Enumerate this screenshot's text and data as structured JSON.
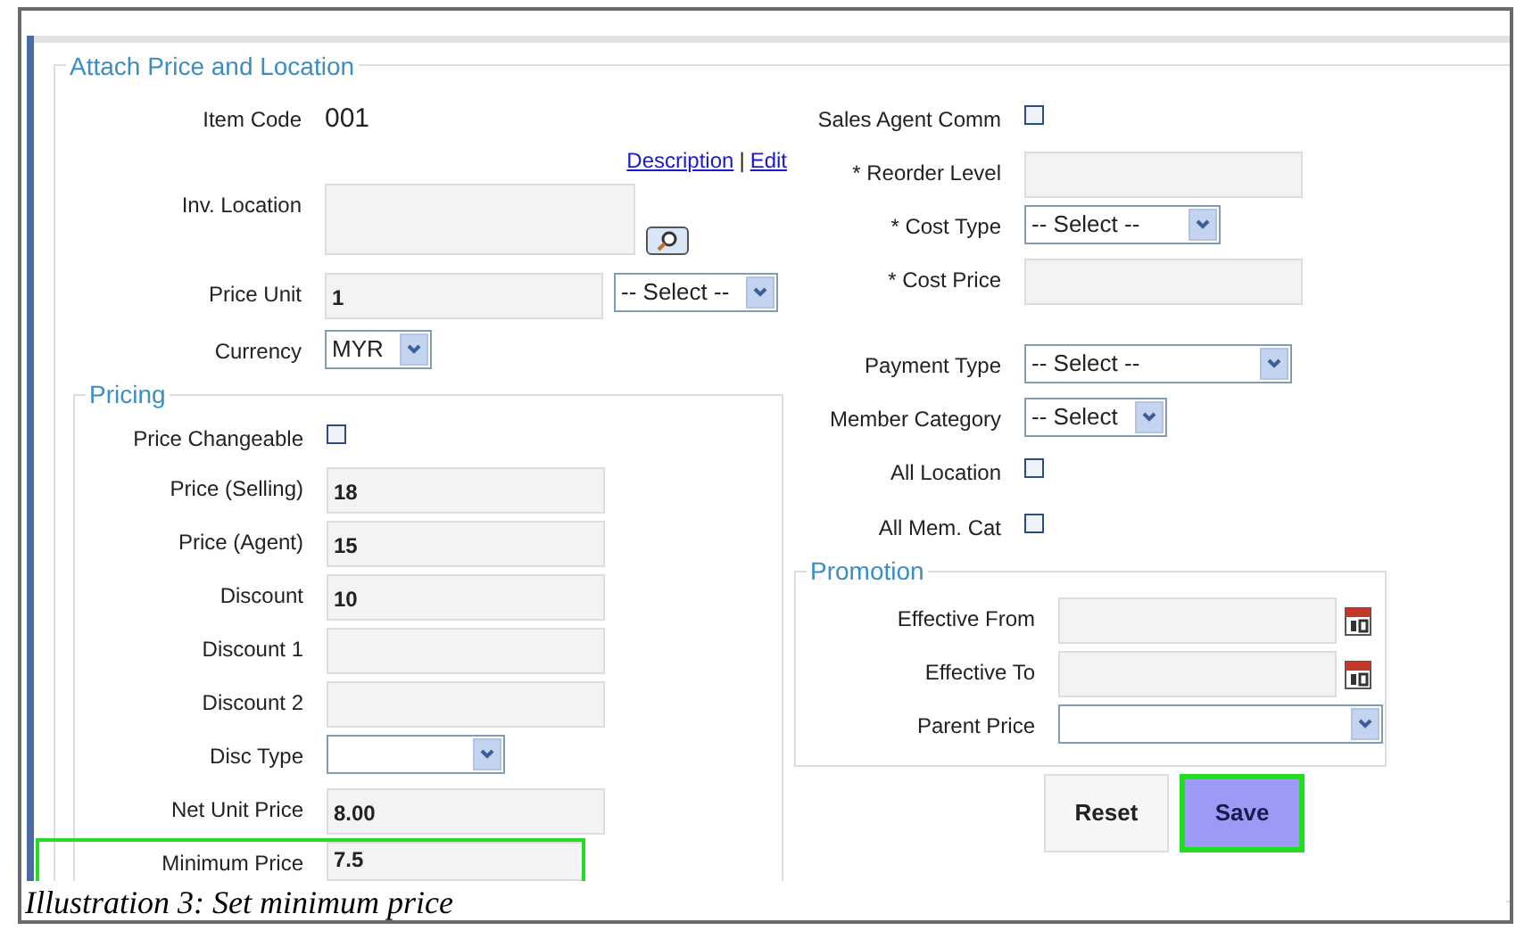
{
  "form": {
    "legend": "Attach Price and Location"
  },
  "left_rows": [
    {
      "kind": "text",
      "label": "Item Code",
      "value": "001"
    },
    {
      "kind": "links",
      "links": [
        "Description",
        "Edit"
      ],
      "separator": "|"
    },
    {
      "kind": "textarea",
      "label": "Inv. Location",
      "value": ""
    },
    {
      "kind": "input_select",
      "label": "Price Unit",
      "value": "1",
      "option": "-- Select --"
    },
    {
      "kind": "select",
      "label": "Currency",
      "value": "MYR"
    }
  ],
  "pricing": {
    "legend": "Pricing",
    "rows": [
      {
        "kind": "checkbox",
        "label": "Price Changeable",
        "checked": false
      },
      {
        "kind": "input",
        "label": "Price (Selling)",
        "value": "18",
        "highlighted": false
      },
      {
        "kind": "input",
        "label": "Price (Agent)",
        "value": "15",
        "highlighted": false
      },
      {
        "kind": "input",
        "label": "Discount",
        "value": "10",
        "highlighted": false
      },
      {
        "kind": "input",
        "label": "Discount 1",
        "value": "",
        "highlighted": false
      },
      {
        "kind": "input",
        "label": "Discount 2",
        "value": "",
        "highlighted": false
      },
      {
        "kind": "select",
        "label": "Disc Type",
        "value": ""
      },
      {
        "kind": "input",
        "label": "Net Unit Price",
        "value": "8.00",
        "highlighted": false
      },
      {
        "kind": "input",
        "label": "Minimum Price",
        "value": "7.5",
        "highlighted": true
      }
    ]
  },
  "right_rows": [
    {
      "kind": "checkbox",
      "label": "Sales Agent Comm",
      "checked": false
    },
    {
      "kind": "input",
      "label": "* Reorder Level",
      "value": ""
    },
    {
      "kind": "select",
      "label": "* Cost Type",
      "value": "-- Select --"
    },
    {
      "kind": "input",
      "label": "* Cost Price",
      "value": ""
    },
    {
      "kind": "spacer"
    },
    {
      "kind": "select",
      "label": "Payment Type",
      "value": "-- Select --"
    },
    {
      "kind": "select",
      "label": "Member Category",
      "value": "-- Select"
    },
    {
      "kind": "checkbox",
      "label": "All Location",
      "checked": false
    },
    {
      "kind": "checkbox",
      "label": "All Mem. Cat",
      "checked": false
    }
  ],
  "promotion": {
    "legend": "Promotion",
    "rows": [
      {
        "kind": "date",
        "label": "Effective From",
        "value": ""
      },
      {
        "kind": "date",
        "label": "Effective To",
        "value": ""
      },
      {
        "kind": "select",
        "label": "Parent Price",
        "value": ""
      }
    ]
  },
  "buttons": [
    {
      "label": "Reset",
      "highlighted": false
    },
    {
      "label": "Save",
      "highlighted": true
    }
  ],
  "caption": "Illustration 3: Set minimum price"
}
